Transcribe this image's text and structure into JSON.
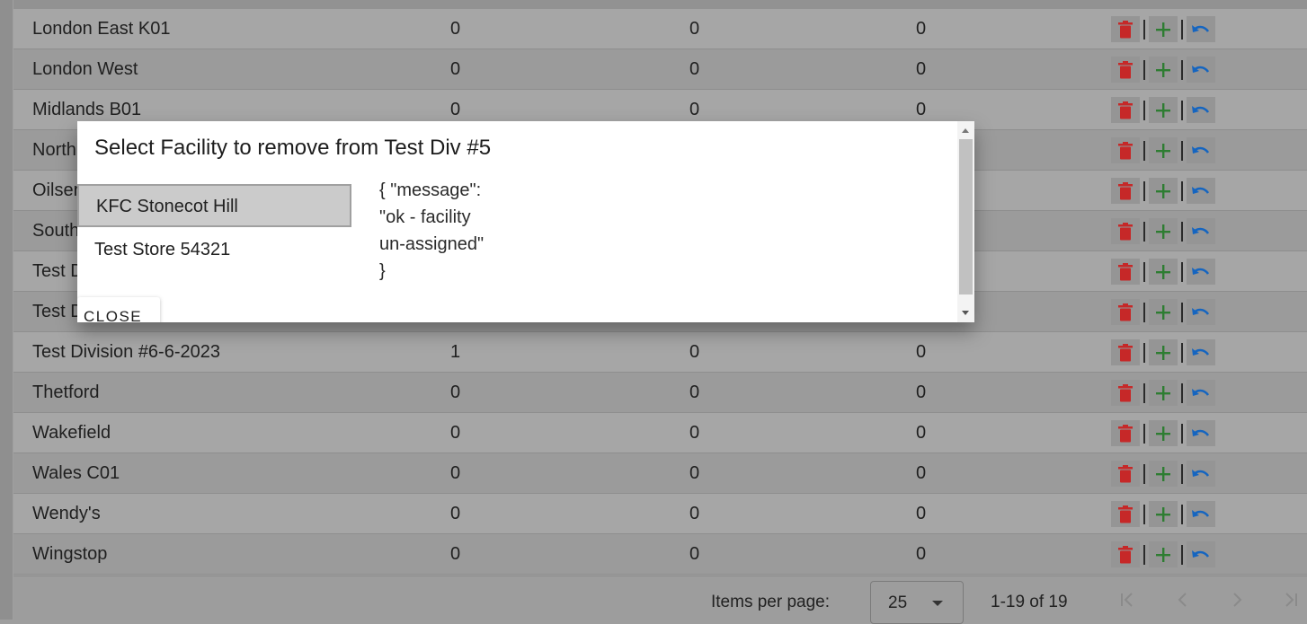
{
  "table": {
    "rows": [
      {
        "name": "London East K01",
        "a": "0",
        "b": "0",
        "c": "0"
      },
      {
        "name": "London West",
        "a": "0",
        "b": "0",
        "c": "0"
      },
      {
        "name": "Midlands B01",
        "a": "0",
        "b": "0",
        "c": "0"
      },
      {
        "name": "North",
        "a": "",
        "b": "",
        "c": ""
      },
      {
        "name": "Oilser",
        "a": "",
        "b": "",
        "c": ""
      },
      {
        "name": "South",
        "a": "",
        "b": "",
        "c": ""
      },
      {
        "name": "Test D",
        "a": "",
        "b": "",
        "c": ""
      },
      {
        "name": "Test D",
        "a": "",
        "b": "",
        "c": ""
      },
      {
        "name": "Test Division #6-6-2023",
        "a": "1",
        "b": "0",
        "c": "0"
      },
      {
        "name": "Thetford",
        "a": "0",
        "b": "0",
        "c": "0"
      },
      {
        "name": "Wakefield",
        "a": "0",
        "b": "0",
        "c": "0"
      },
      {
        "name": "Wales C01",
        "a": "0",
        "b": "0",
        "c": "0"
      },
      {
        "name": "Wendy's",
        "a": "0",
        "b": "0",
        "c": "0"
      },
      {
        "name": "Wingstop",
        "a": "0",
        "b": "0",
        "c": "0"
      }
    ],
    "action_colors": {
      "delete": "#c62828",
      "add": "#2e7d32",
      "undo": "#1565c0"
    }
  },
  "paginator": {
    "items_per_page_label": "Items per page:",
    "page_size": "25",
    "range": "1-19 of 19"
  },
  "modal": {
    "title": "Select Facility to remove from Test Div #5",
    "facilities": [
      "KFC Stonecot Hill",
      "Test Store 54321"
    ],
    "selected_index": 0,
    "response": "{ \"message\":\n\"ok - facility\nun-assigned\"\n}",
    "close_label": "CLOSE"
  }
}
